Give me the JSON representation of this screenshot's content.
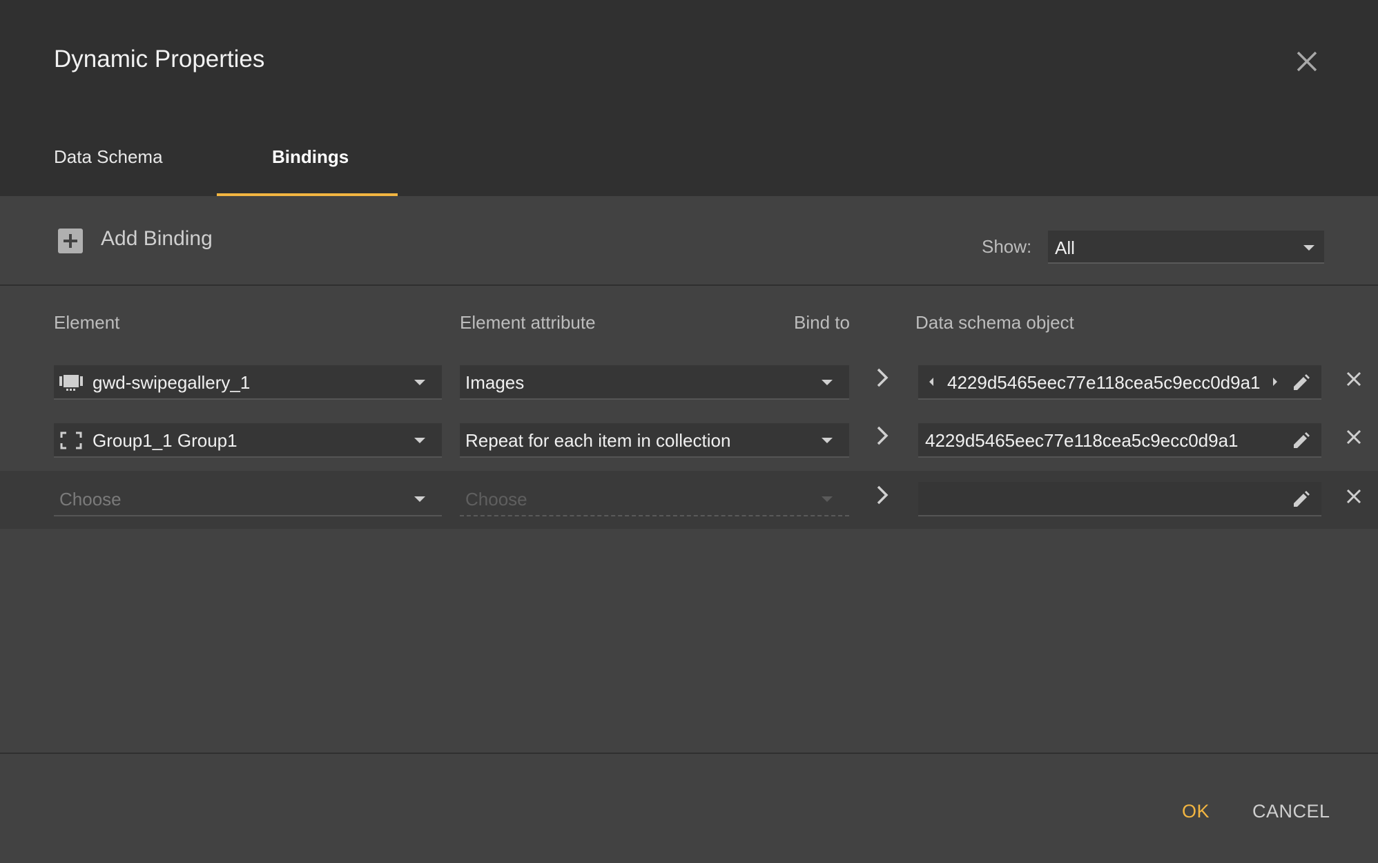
{
  "dialog": {
    "title": "Dynamic Properties",
    "close_icon": "close-icon"
  },
  "tabs": [
    {
      "label": "Data Schema",
      "active": false
    },
    {
      "label": "Bindings",
      "active": true
    }
  ],
  "toolbar": {
    "add_label": "Add Binding",
    "add_icon": "plus-box-icon",
    "show_label": "Show:",
    "show_value": "All"
  },
  "columns": {
    "element": "Element",
    "attribute": "Element attribute",
    "bind_to": "Bind to",
    "schema_object": "Data schema object"
  },
  "rows": [
    {
      "element": "gwd-swipegallery_1",
      "element_icon": "gallery-icon",
      "attribute": "Images",
      "schema_object": "4229d5465eec77e118cea5c9ecc0d9a1",
      "schema_has_arrows": true
    },
    {
      "element": "Group1_1 Group1",
      "element_icon": "group-bracket-icon",
      "attribute": "Repeat for each item in collection",
      "schema_object": "4229d5465eec77e118cea5c9ecc0d9a1",
      "schema_has_arrows": false
    },
    {
      "element_placeholder": "Choose",
      "attribute_placeholder": "Choose",
      "schema_object": ""
    }
  ],
  "footer": {
    "ok_label": "OK",
    "cancel_label": "CANCEL"
  },
  "colors": {
    "accent": "#f2b541",
    "header_bg": "#303030",
    "body_bg": "#424242"
  }
}
